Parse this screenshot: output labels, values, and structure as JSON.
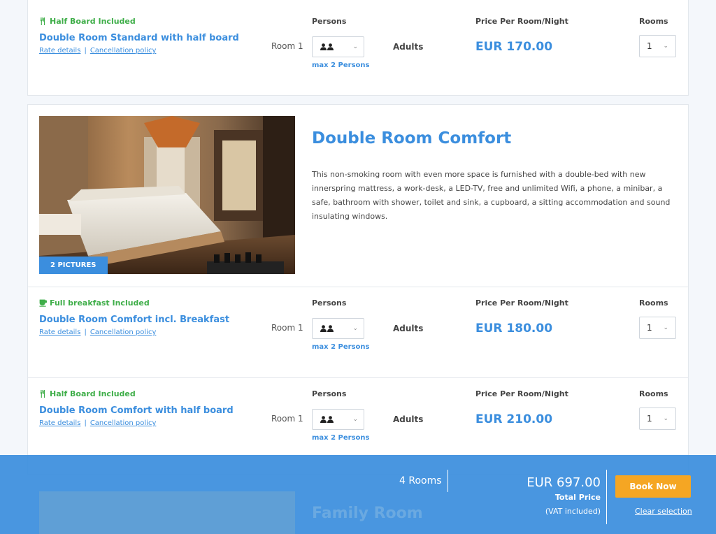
{
  "top_rate": {
    "plan": "Half Board Included",
    "name": "Double Room Standard with half board",
    "rate_details": "Rate details",
    "cancellation": "Cancellation policy",
    "room_label": "Room 1",
    "persons_header": "Persons",
    "max_persons": "max 2 Persons",
    "adults": "Adults",
    "price_header": "Price Per Room/Night",
    "price": "EUR 170.00",
    "rooms_header": "Rooms",
    "rooms_value": "1"
  },
  "room": {
    "title": "Double Room Comfort",
    "description": "This non-smoking room with even more space is furnished with a double-bed with new innerspring mattress, a work-desk, a LED-TV, free and unlimited Wifi, a phone, a minibar, a safe, bathroom with shower, toilet and sink, a cupboard, a sitting accommodation and sound insulating windows.",
    "pictures_badge": "2 PICTURES",
    "rates": [
      {
        "plan": "Full breakfast Included",
        "plan_icon": "coffee-cup-icon",
        "name": "Double Room Comfort incl. Breakfast",
        "rate_details": "Rate details",
        "cancellation": "Cancellation policy",
        "room_label": "Room 1",
        "persons_header": "Persons",
        "max_persons": "max 2 Persons",
        "adults": "Adults",
        "price_header": "Price Per Room/Night",
        "price": "EUR 180.00",
        "rooms_header": "Rooms",
        "rooms_value": "1"
      },
      {
        "plan": "Half Board Included",
        "plan_icon": "fork-knife-icon",
        "name": "Double Room Comfort with half board",
        "rate_details": "Rate details",
        "cancellation": "Cancellation policy",
        "room_label": "Room 1",
        "persons_header": "Persons",
        "max_persons": "max 2 Persons",
        "adults": "Adults",
        "price_header": "Price Per Room/Night",
        "price": "EUR 210.00",
        "rooms_header": "Rooms",
        "rooms_value": "1"
      }
    ]
  },
  "next_room": {
    "title": "Family Room"
  },
  "footer": {
    "rooms_count": "4 Rooms",
    "total": "EUR 697.00",
    "total_label": "Total Price",
    "vat": "(VAT included)",
    "book": "Book Now",
    "clear": "Clear selection"
  },
  "colors": {
    "accent": "#3b8ede",
    "plan_green": "#3fae49",
    "book_orange": "#f5a623"
  }
}
